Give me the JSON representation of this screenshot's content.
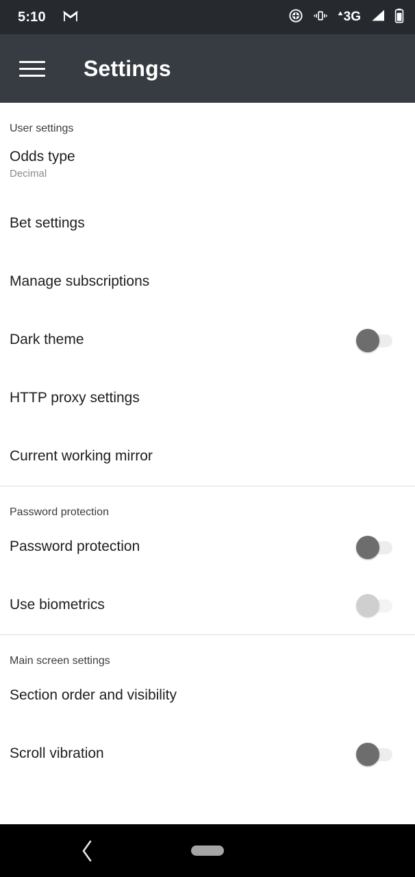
{
  "status_bar": {
    "clock": "5:10",
    "left_icons": [
      {
        "name": "gmail-icon",
        "label": "M"
      }
    ],
    "right_icons": [
      {
        "name": "data-saver-icon",
        "label": "data saver"
      },
      {
        "name": "vibrate-mode-icon",
        "label": "vibrate"
      },
      {
        "name": "network-type-3g-icon",
        "label": "3G"
      },
      {
        "name": "signal-strength-icon",
        "label": "signal"
      },
      {
        "name": "battery-icon",
        "label": "battery"
      }
    ],
    "background": "#26292e"
  },
  "toolbar": {
    "menu_icon": "hamburger-menu-icon",
    "title": "Settings",
    "background": "#373c42"
  },
  "sections": [
    {
      "header": "User settings",
      "items": [
        {
          "title": "Odds type",
          "summary": "Decimal",
          "control": "none"
        },
        {
          "title": "Bet settings",
          "summary": "",
          "control": "none"
        },
        {
          "title": "Manage subscriptions",
          "summary": "",
          "control": "none"
        },
        {
          "title": "Dark theme",
          "summary": "",
          "control": "switch",
          "checked": false,
          "enabled": true
        },
        {
          "title": "HTTP proxy settings",
          "summary": "",
          "control": "none"
        },
        {
          "title": "Current working mirror",
          "summary": "",
          "control": "none"
        }
      ]
    },
    {
      "header": "Password protection",
      "items": [
        {
          "title": "Password protection",
          "summary": "",
          "control": "switch",
          "checked": false,
          "enabled": true
        },
        {
          "title": "Use biometrics",
          "summary": "",
          "control": "switch",
          "checked": false,
          "enabled": false
        }
      ]
    },
    {
      "header": "Main screen settings",
      "items": [
        {
          "title": "Section order and visibility",
          "summary": "",
          "control": "none"
        },
        {
          "title": "Scroll vibration",
          "summary": "",
          "control": "switch",
          "checked": false,
          "enabled": true
        }
      ]
    }
  ],
  "nav_bar": {
    "back_icon": "back-chevron-icon",
    "home_indicator": "home-pill-indicator",
    "background": "#000000"
  },
  "colors": {
    "status_bar": "#26292e",
    "toolbar": "#373c42",
    "page_background": "#ffffff",
    "primary_text": "#1d1d1d",
    "secondary_text": "#8a8a8a",
    "header_text": "#3b3b3b",
    "divider": "#dddddd",
    "switch_thumb_on_dark": "#6d6d6d",
    "switch_thumb_disabled": "#cfcfcf",
    "switch_track": "#eceded",
    "nav_home_pill": "#a5a5a5"
  }
}
